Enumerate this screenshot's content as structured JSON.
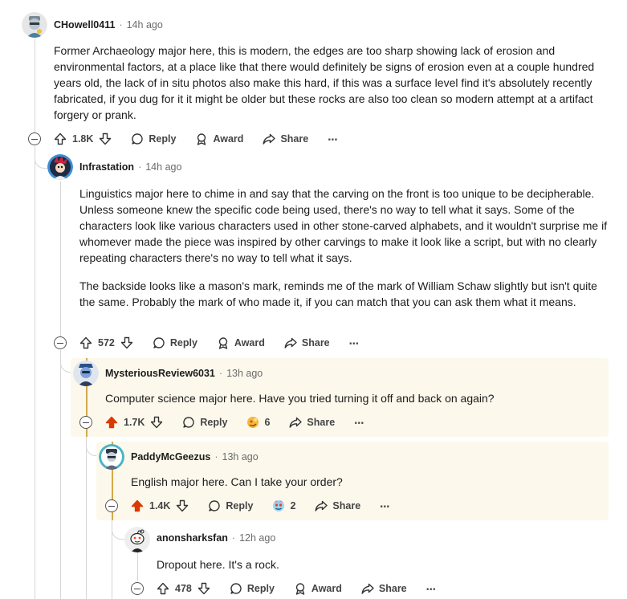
{
  "comments": [
    {
      "author": "CHowell0411",
      "time": "14h ago",
      "paragraphs": [
        "Former Archaeology major here, this is modern, the edges are too sharp showing lack of erosion and environmental factors, at a place like that there would definitely be signs of erosion even at a couple hundred years old, the lack of in situ photos also make this hard, if this was a surface level find it's absolutely recently fabricated, if you dug for it it might be older but these rocks are also too clean so modern attempt at a artifact forgery or prank."
      ],
      "votes": "1.8K",
      "reply": "Reply",
      "award": "Award",
      "share": "Share",
      "more": "⋯"
    },
    {
      "author": "Infrastation",
      "time": "14h ago",
      "paragraphs": [
        "Linguistics major here to chime in and say that the carving on the front is too unique to be decipherable. Unless someone knew the specific code being used, there's no way to tell what it says. Some of the characters look like various characters used in other stone-carved alphabets, and it wouldn't surprise me if whomever made the piece was inspired by other carvings to make it look like a script, but with no clearly repeating characters there's no way to tell what it says.",
        "The backside looks like a mason's mark, reminds me of the mark of William Schaw slightly but isn't quite the same. Probably the mark of who made it, if you can match that you can ask them what it means."
      ],
      "votes": "572",
      "reply": "Reply",
      "award": "Award",
      "share": "Share",
      "more": "⋯"
    },
    {
      "author": "MysteriousReview6031",
      "time": "13h ago",
      "paragraphs": [
        "Computer science major here. Have you tried turning it off and back on again?"
      ],
      "votes": "1.7K",
      "reply": "Reply",
      "award_count": "6",
      "share": "Share",
      "more": "⋯"
    },
    {
      "author": "PaddyMcGeezus",
      "time": "13h ago",
      "paragraphs": [
        "English major here. Can I take your order?"
      ],
      "votes": "1.4K",
      "reply": "Reply",
      "award_count": "2",
      "share": "Share",
      "more": "⋯"
    },
    {
      "author": "anonsharksfan",
      "time": "12h ago",
      "paragraphs": [
        "Dropout here. It's a rock."
      ],
      "votes": "478",
      "reply": "Reply",
      "award": "Award",
      "share": "Share",
      "more": "⋯"
    }
  ],
  "colors": {
    "upvoted": "#d93a00",
    "highlight_bg": "#fcf8ec",
    "highlight_border": "#d5a94a",
    "thread_line": "#d6d6d6"
  }
}
